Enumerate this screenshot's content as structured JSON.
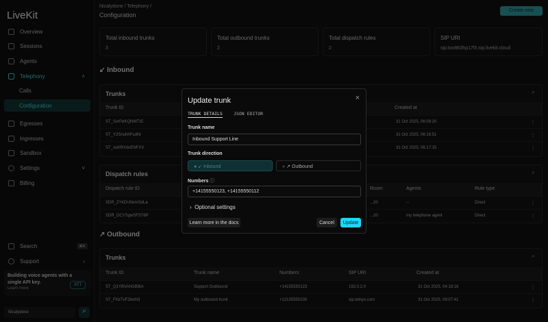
{
  "sidebar": {
    "logo": "LiveKit",
    "items": [
      {
        "label": "Overview"
      },
      {
        "label": "Sessions"
      },
      {
        "label": "Agents"
      },
      {
        "label": "Telephony"
      },
      {
        "label": "Calls"
      },
      {
        "label": "Configuration"
      },
      {
        "label": "Egresses"
      },
      {
        "label": "Ingresses"
      },
      {
        "label": "Sandbox"
      },
      {
        "label": "Settings"
      },
      {
        "label": "Billing"
      }
    ],
    "search": "Search",
    "search_shortcut": "⌘K",
    "support": "Support",
    "promo": {
      "text": "Building voice agents with a single API key.",
      "link": "Learn more",
      "badge": "STT"
    },
    "project": "Nicalydone",
    "project_avatar": "P"
  },
  "header": {
    "breadcrumb": [
      "Nicalydone",
      "Telephony"
    ],
    "title": "Configuration",
    "create_button": "Create new"
  },
  "stats": [
    {
      "label": "Total inbound trunks",
      "value": "3"
    },
    {
      "label": "Total outbound trunks",
      "value": "2"
    },
    {
      "label": "Total dispatch rules",
      "value": "2"
    },
    {
      "label": "SIP URI",
      "value": "sip:too963hp17l5.sip.livekit.cloud"
    }
  ],
  "inbound": {
    "title": "Inbound",
    "trunks": {
      "title": "Trunks",
      "columns": [
        "Trunk ID",
        "Created at"
      ],
      "rows": [
        {
          "id": "ST_SvrPeKQNWTtC",
          "created": "31 Oct 2025, 06:08:20"
        },
        {
          "id": "ST_Y2SnuhhFudNi",
          "created": "31 Oct 2025, 06:16:51"
        },
        {
          "id": "ST_vuKRXdoENFXV",
          "created": "31 Oct 2025, 06:17:15"
        }
      ]
    },
    "dispatch": {
      "title": "Dispatch rules",
      "columns": [
        "Dispatch rule ID",
        "Room",
        "Agents",
        "Rule type"
      ],
      "rows": [
        {
          "id": "SDR_ZYkDUNxmSdLa",
          "room": "...20",
          "agents": "--",
          "type": "Direct"
        },
        {
          "id": "SDR_DCYSgwSFS76P",
          "room": "...20",
          "agents": "my telephone agent",
          "type": "Direct"
        }
      ]
    }
  },
  "outbound": {
    "title": "Outbound",
    "trunks": {
      "title": "Trunks",
      "columns": [
        "Trunk ID",
        "Trunk name",
        "Numbers",
        "SIP URI",
        "Created at"
      ],
      "rows": [
        {
          "id": "ST_Q1YBVAhGB9tA",
          "name": "Support Outbound",
          "numbers": "+14155550123",
          "uri": "192.0.2.0",
          "created": "31 Oct 2025, 04:18:16"
        },
        {
          "id": "ST_FNzTvF2bxth3",
          "name": "My outbound trunk",
          "numbers": "+12135550100",
          "uri": "sip.telnyx.com",
          "created": "31 Oct 2025, 09:07:41"
        }
      ]
    }
  },
  "modal": {
    "title": "Update trunk",
    "tabs": [
      "TRUNK DETAILS",
      "JSON EDITOR"
    ],
    "trunk_name_label": "Trunk name",
    "trunk_name_value": "Inbound Support Line",
    "direction_label": "Trunk direction",
    "direction_options": [
      "Inbound",
      "Outbound"
    ],
    "direction_selected": "Inbound",
    "numbers_label": "Numbers",
    "numbers_value": "+14155550123, +14155550112",
    "optional": "Optional settings",
    "docs_button": "Learn more in the docs",
    "cancel": "Cancel",
    "update": "Update"
  },
  "colors": {
    "accent": "#1fd5f9",
    "teal": "#3ec3c9"
  }
}
